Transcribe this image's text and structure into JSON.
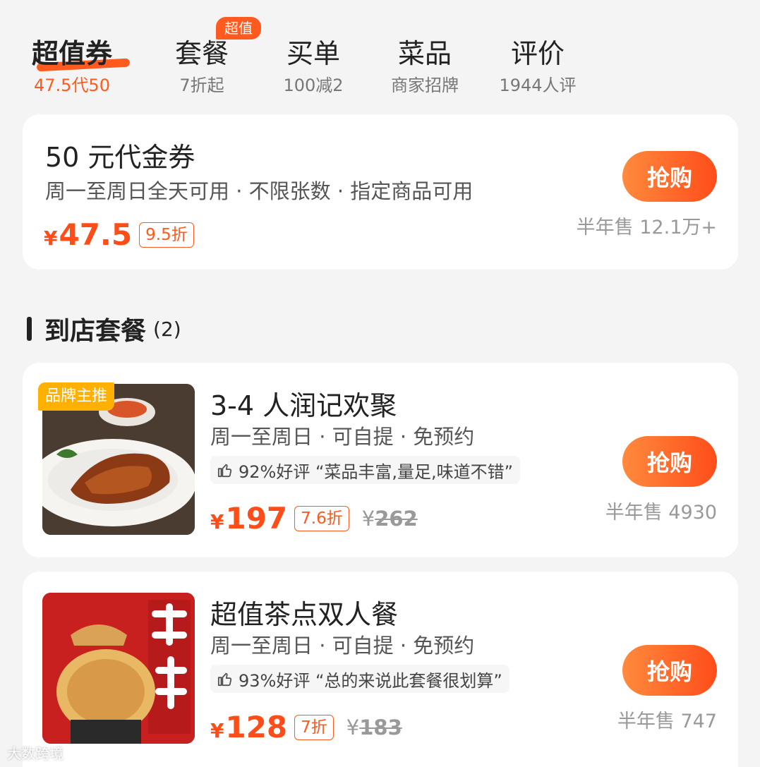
{
  "tabs": [
    {
      "label": "超值券",
      "sub": "47.5代50"
    },
    {
      "label": "套餐",
      "sub": "7折起"
    },
    {
      "label": "买单",
      "sub": "100减2"
    },
    {
      "label": "菜品",
      "sub": "商家招牌"
    },
    {
      "label": "评价",
      "sub": "1944人评"
    }
  ],
  "hot_badge": "超值",
  "voucher": {
    "title": "50 元代金券",
    "desc": "周一至周日全天可用 · 不限张数 · 指定商品可用",
    "currency": "¥",
    "price": "47.5",
    "discount": "9.5折",
    "buy_label": "抢购",
    "sales": "半年售 12.1万+"
  },
  "section": {
    "title": "到店套餐",
    "count": "(2)"
  },
  "packages": [
    {
      "tag": "品牌主推",
      "title": "3-4 人润记欢聚",
      "desc": "周一至周日 · 可自提 · 免预约",
      "review": "92%好评 “菜品丰富,量足,味道不错”",
      "currency": "¥",
      "price": "197",
      "discount": "7.6折",
      "orig_currency": "¥",
      "orig_price": "262",
      "buy_label": "抢购",
      "sales": "半年售 4930"
    },
    {
      "title": "超值茶点双人餐",
      "desc": "周一至周日 · 可自提 · 免预约",
      "review": "93%好评 “总的来说此套餐很划算”",
      "currency": "¥",
      "price": "128",
      "discount": "7折",
      "orig_currency": "¥",
      "orig_price": "183",
      "buy_label": "抢购",
      "sales": "半年售 747"
    }
  ],
  "watermark": "大数跨境",
  "colors": {
    "accent": "#ff5a1f",
    "price": "#ff4d1a",
    "tag": "#ffb000"
  },
  "icons": [
    "thumbs-up-icon"
  ]
}
